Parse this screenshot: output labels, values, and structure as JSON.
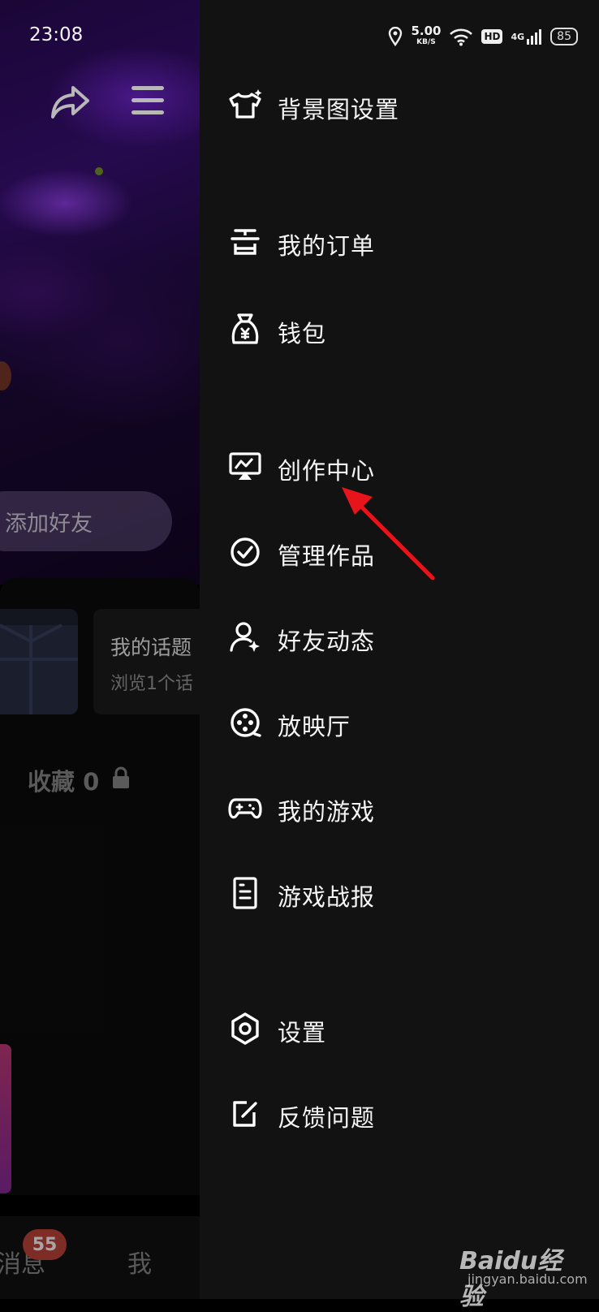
{
  "status_bar": {
    "time": "23:08",
    "speed_value": "5.00",
    "speed_unit": "KB/S",
    "network": "4G",
    "hd": "HD",
    "battery": "85"
  },
  "profile": {
    "add_friend": "添加好友",
    "topic_title": "我的话题",
    "topic_sub": "浏览1个话",
    "favorites_label": "收藏 0"
  },
  "tabbar": {
    "messages_label": "消息",
    "messages_badge": "55",
    "me_label": "我"
  },
  "drawer": {
    "items": [
      {
        "label": "背景图设置",
        "icon": "shirt-icon"
      },
      {
        "label": "我的订单",
        "icon": "order-icon"
      },
      {
        "label": "钱包",
        "icon": "wallet-icon"
      },
      {
        "label": "创作中心",
        "icon": "creator-center-icon"
      },
      {
        "label": "管理作品",
        "icon": "check-circle-icon"
      },
      {
        "label": "好友动态",
        "icon": "friend-activity-icon"
      },
      {
        "label": "放映厅",
        "icon": "film-reel-icon"
      },
      {
        "label": "我的游戏",
        "icon": "gamepad-icon"
      },
      {
        "label": "游戏战报",
        "icon": "report-icon"
      },
      {
        "label": "设置",
        "icon": "settings-icon"
      },
      {
        "label": "反馈问题",
        "icon": "feedback-icon"
      }
    ]
  },
  "watermark": {
    "brand": "Baidu经验",
    "url": "jingyan.baidu.com"
  },
  "colors": {
    "drawer_bg": "#121212",
    "arrow": "#e8141c",
    "badge": "#c0453a"
  }
}
